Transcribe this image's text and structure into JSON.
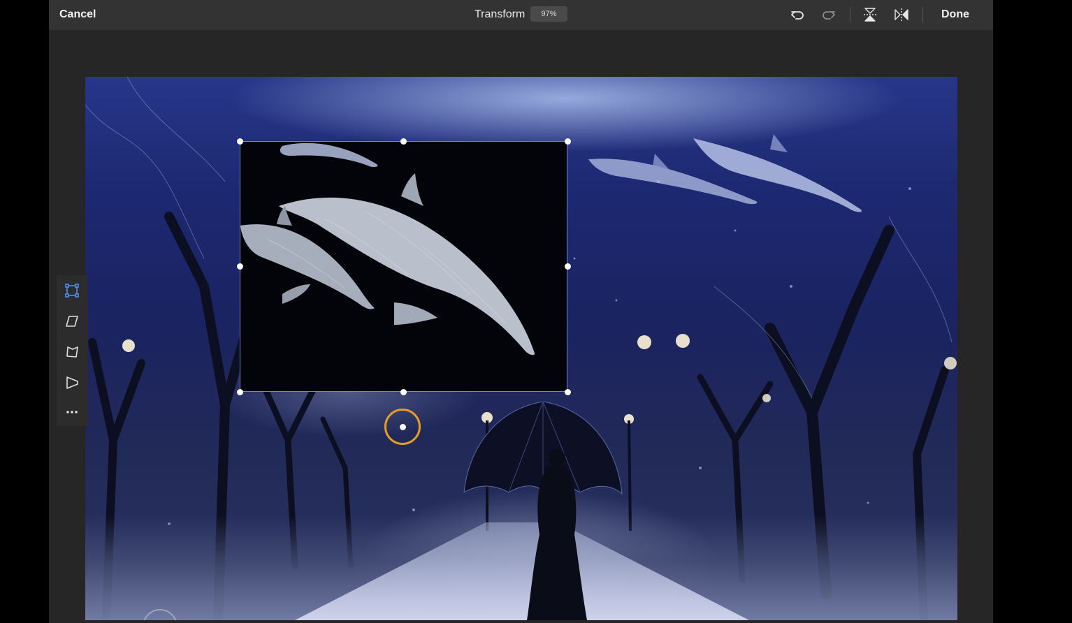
{
  "topbar": {
    "cancel_label": "Cancel",
    "title": "Transform",
    "zoom": "97%",
    "done_label": "Done",
    "icons": [
      "undo-icon",
      "redo-icon",
      "flip-vertical-icon",
      "flip-horizontal-icon"
    ]
  },
  "tool_rail": {
    "tools": [
      "free-transform-icon",
      "skew-icon",
      "distort-icon",
      "perspective-icon",
      "more-icon"
    ],
    "selected": "free-transform-icon"
  },
  "colors": {
    "topbar_bg": "#333333",
    "app_bg": "#262626",
    "selection_border": "#6f86d6",
    "rotate_ring": "#e8a020",
    "active_tool": "#4d8ff0"
  }
}
